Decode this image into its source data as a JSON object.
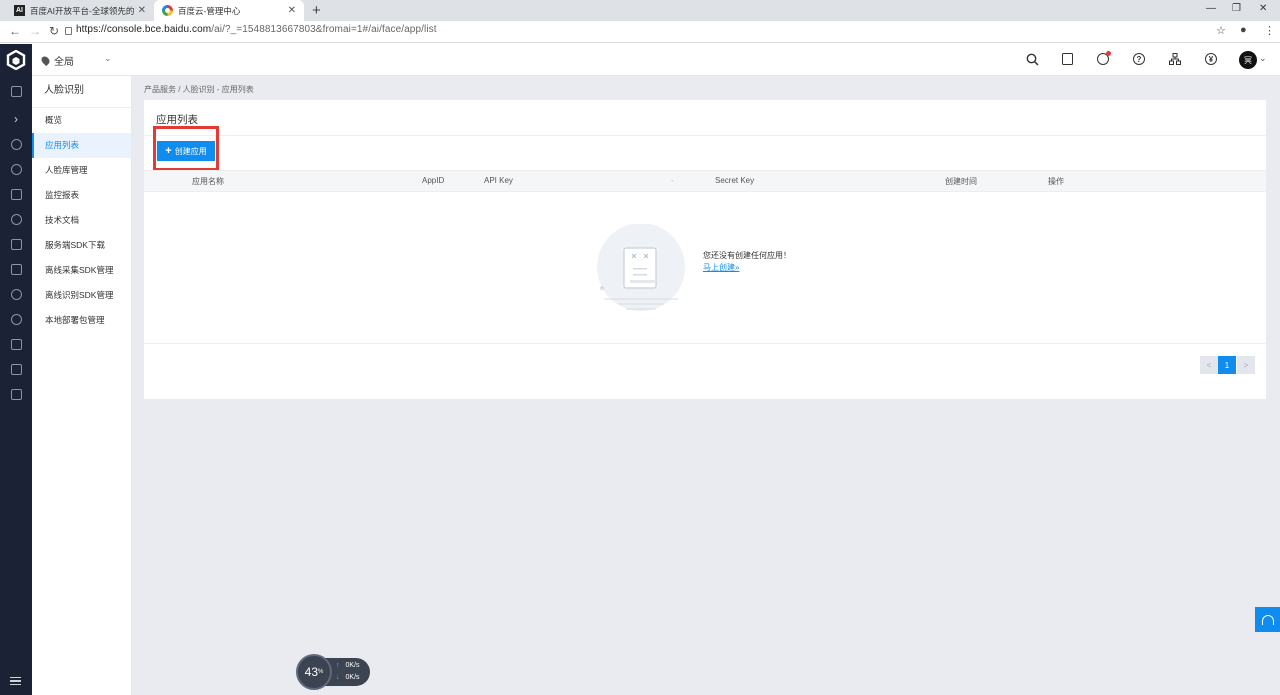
{
  "browser": {
    "tabs": [
      {
        "title": "百度AI开放平台-全球领先的人工",
        "favicon": "ai-logo-icon",
        "active": false
      },
      {
        "title": "百度云-管理中心",
        "favicon": "baidu-cloud-icon",
        "active": true
      }
    ],
    "url_host": "https://console.bce.baidu.com",
    "url_rest": "/ai/?_=1548813667803&fromai=1#/ai/face/app/list"
  },
  "header": {
    "region_label": "全局",
    "avatar_text": "冥",
    "icons": [
      "search-icon",
      "document-icon",
      "message-icon",
      "help-icon",
      "org-chart-icon",
      "yuan-currency-icon"
    ]
  },
  "sidebar": {
    "title": "人脸识别",
    "items": [
      {
        "label": "概览"
      },
      {
        "label": "应用列表",
        "active": true
      },
      {
        "label": "人脸库管理"
      },
      {
        "label": "监控报表"
      },
      {
        "label": "技术文档"
      },
      {
        "label": "服务端SDK下载"
      },
      {
        "label": "离线采集SDK管理"
      },
      {
        "label": "离线识别SDK管理"
      },
      {
        "label": "本地部署包管理"
      }
    ]
  },
  "main": {
    "breadcrumb": "产品服务 / 人脸识别 - 应用列表",
    "title": "应用列表",
    "create_button": "创建应用",
    "table": {
      "columns": [
        "应用名称",
        "AppID",
        "API Key",
        "-",
        "Secret Key",
        "创建时间",
        "操作"
      ]
    },
    "empty_message": "您还没有创建任何应用！",
    "empty_link": "马上创建»",
    "pagination": {
      "prev": "<",
      "current": "1",
      "next": ">"
    }
  },
  "speed_widget": {
    "percent": "43",
    "percent_unit": "%",
    "upload": "0",
    "download": "0",
    "unit": "K/s"
  },
  "colors": {
    "accent": "#108cee",
    "rail_bg": "#1b2235",
    "highlight": "#e53935"
  }
}
